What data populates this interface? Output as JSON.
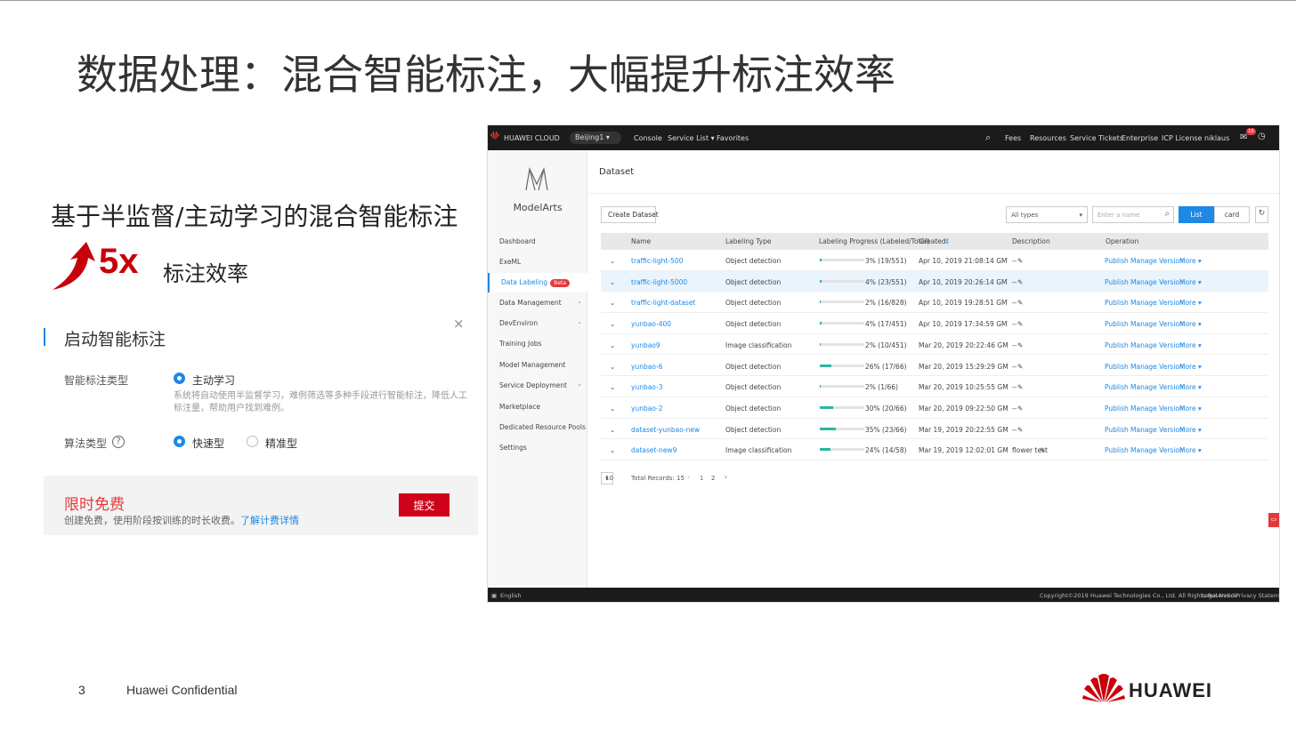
{
  "slide": {
    "title": "数据处理：混合智能标注，大幅提升标注效率",
    "subtitle": "基于半监督/主动学习的混合智能标注",
    "boost_value": "5x",
    "boost_text": "标注效率",
    "page_number": "3",
    "confidential": "Huawei Confidential",
    "brand": "HUAWEI",
    "brand_color": "#c7000b"
  },
  "dialog": {
    "title": "启动智能标注",
    "close": "×",
    "type_label": "智能标注类型",
    "type_option": "主动学习",
    "type_desc": "系统将自动使用半监督学习，难例筛选等多种手段进行智能标注，降低人工标注量，帮助用户找到难例。",
    "algo_label": "算法类型",
    "help": "?",
    "algo_options": [
      "快速型",
      "精准型"
    ],
    "free_title": "限时免费",
    "free_desc": "创建免费，使用阶段按训练的时长收费。",
    "free_link": "了解计费详情",
    "submit": "提交"
  },
  "console": {
    "topbar": {
      "brand": "HUAWEI CLOUD",
      "region": "Beijing1",
      "links": [
        "Console",
        "Service List ▾",
        "Favorites"
      ],
      "right": [
        "Fees",
        "Resources",
        "Service Tickets",
        "Enterprise",
        "ICP License",
        "niklaus"
      ],
      "badge": "16"
    },
    "sidebar": {
      "app": "ModelArts",
      "items": [
        "Dashboard",
        "ExeML",
        "Data Labeling",
        "Data Management",
        "DevEnviron",
        "Training Jobs",
        "Model Management",
        "Service Deployment",
        "Marketplace",
        "Dedicated Resource Pools",
        "Settings"
      ],
      "beta": "Beta"
    },
    "page_title": "Dataset",
    "create": "Create Dataset",
    "filter": "All types",
    "search_placeholder": "Enter a name",
    "view_list": "List",
    "view_card": "card",
    "columns": [
      "Name",
      "Labeling Type",
      "Labeling Progress (Labeled/Total)",
      "Created",
      "Description",
      "Operation"
    ],
    "rows": [
      {
        "name": "traffic-light-500",
        "type": "Object detection",
        "progress": 0.03,
        "progress_text": "3% (19/551)",
        "created": "Apr 10, 2019 21:08:14 GMT+08...",
        "desc": "--"
      },
      {
        "name": "traffic-light-5000",
        "type": "Object detection",
        "progress": 0.04,
        "progress_text": "4% (23/551)",
        "created": "Apr 10, 2019 20:26:14 GMT+08...",
        "desc": "--"
      },
      {
        "name": "traffic-light-dataset",
        "type": "Object detection",
        "progress": 0.02,
        "progress_text": "2% (16/828)",
        "created": "Apr 10, 2019 19:28:51 GMT+08...",
        "desc": "--"
      },
      {
        "name": "yunbao-400",
        "type": "Object detection",
        "progress": 0.04,
        "progress_text": "4% (17/451)",
        "created": "Apr 10, 2019 17:34:59 GMT+08...",
        "desc": "--"
      },
      {
        "name": "yunbao9",
        "type": "Image classification",
        "progress": 0.02,
        "progress_text": "2% (10/451)",
        "created": "Mar 20, 2019 20:22:46 GMT+0...",
        "desc": "--"
      },
      {
        "name": "yunbao-6",
        "type": "Object detection",
        "progress": 0.26,
        "progress_text": "26% (17/66)",
        "created": "Mar 20, 2019 15:29:29 GMT+0...",
        "desc": "--"
      },
      {
        "name": "yunbao-3",
        "type": "Object detection",
        "progress": 0.02,
        "progress_text": "2% (1/66)",
        "created": "Mar 20, 2019 10:25:55 GMT+0...",
        "desc": "--"
      },
      {
        "name": "yunbao-2",
        "type": "Object detection",
        "progress": 0.3,
        "progress_text": "30% (20/66)",
        "created": "Mar 20, 2019 09:22:50 GMT+0...",
        "desc": "--"
      },
      {
        "name": "dataset-yunbao-new",
        "type": "Object detection",
        "progress": 0.35,
        "progress_text": "35% (23/66)",
        "created": "Mar 19, 2019 20:22:55 GMT+0...",
        "desc": "--"
      },
      {
        "name": "dataset-new9",
        "type": "Image classification",
        "progress": 0.24,
        "progress_text": "24% (14/58)",
        "created": "Mar 19, 2019 12:02:01 GMT+0...",
        "desc": "flower test"
      }
    ],
    "ops": [
      "Publish",
      "Manage Version",
      "More ▾"
    ],
    "pager": {
      "size": "10",
      "total": "Total Records: 15",
      "pages": [
        "1",
        "2"
      ]
    },
    "footer": {
      "lang": "English",
      "copyright": "Copyright©2019 Huawei Technologies Co., Ltd. All Rights Reserved",
      "legal": "Legal Notice",
      "privacy": "Privacy Statement"
    }
  }
}
